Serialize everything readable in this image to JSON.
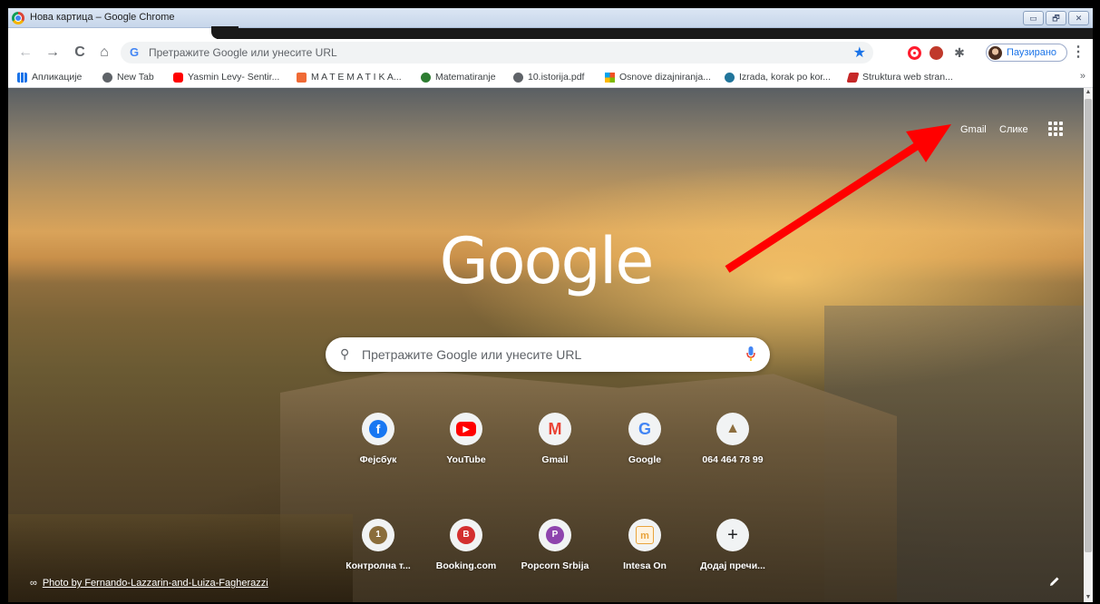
{
  "window": {
    "title": "Нова картица – Google Chrome",
    "controls": [
      "▭",
      "🗗",
      "✕"
    ]
  },
  "toolbar": {
    "back": "←",
    "forward": "→",
    "reload": "C",
    "home": "⌂",
    "omnibox_icon": "G",
    "omnibox_text": "Претражите Google или унесите URL",
    "star": "★",
    "profile_label": "Паузирано",
    "menu": "⋮"
  },
  "bookmarks": [
    {
      "label": "Апликације",
      "icon": "apps-grid-icon",
      "color": "#1a73e8"
    },
    {
      "label": "New Tab",
      "icon": "globe-icon",
      "color": "#5f6368"
    },
    {
      "label": "Yasmin Levy- Sentir...",
      "icon": "youtube-icon",
      "color": "#ff0000"
    },
    {
      "label": "M A T E M A T I K A...",
      "icon": "blogger-icon",
      "color": "#f06a35"
    },
    {
      "label": "Matematiranje",
      "icon": "circle-icon",
      "color": "#2e7d32"
    },
    {
      "label": "10.istorija.pdf",
      "icon": "globe-icon",
      "color": "#5f6368"
    },
    {
      "label": "Osnove dizajniranja...",
      "icon": "windows-icon",
      "color": "#00a4ef"
    },
    {
      "label": "Izrada, korak po kor...",
      "icon": "wordpress-icon",
      "color": "#21759b"
    },
    {
      "label": "Struktura web stran...",
      "icon": "ita-icon",
      "color": "#c62828"
    }
  ],
  "bookmarks_more": "»",
  "header_links": {
    "gmail": "Gmail",
    "images": "Слике"
  },
  "logo": "Google",
  "search": {
    "placeholder": "Претражите Google или унесите URL"
  },
  "shortcuts": [
    {
      "label": "Фејсбук",
      "icon": "facebook-icon",
      "color": "#1877f2",
      "glyph": "f"
    },
    {
      "label": "YouTube",
      "icon": "youtube-icon",
      "color": "#ff0000",
      "glyph": "▶"
    },
    {
      "label": "Gmail",
      "icon": "gmail-icon",
      "color": "#ea4335",
      "glyph": "M"
    },
    {
      "label": "Google",
      "icon": "google-icon",
      "color": "#4285f4",
      "glyph": "G"
    },
    {
      "label": "064 464 78 99",
      "icon": "pyramid-icon",
      "color": "#8d6e3f",
      "glyph": "▲"
    },
    {
      "label": "Контролна т...",
      "icon": "letter-icon",
      "color": "#8a6d3b",
      "glyph": "1"
    },
    {
      "label": "Booking.com",
      "icon": "letter-icon",
      "color": "#d32f2f",
      "glyph": "B"
    },
    {
      "label": "Popcorn Srbija",
      "icon": "letter-icon",
      "color": "#8e44ad",
      "glyph": "P"
    },
    {
      "label": "Intesa On",
      "icon": "intesa-icon",
      "color": "#e8a33c",
      "glyph": "m"
    },
    {
      "label": "Додај пречи...",
      "icon": "plus-icon",
      "color": "#202124",
      "glyph": "+"
    }
  ],
  "attribution": "Photo by Fernando-Lazzarin-and-Luiza-Fagherazzi",
  "colors": {
    "accent": "#1a73e8",
    "arrow": "#ff0000"
  }
}
